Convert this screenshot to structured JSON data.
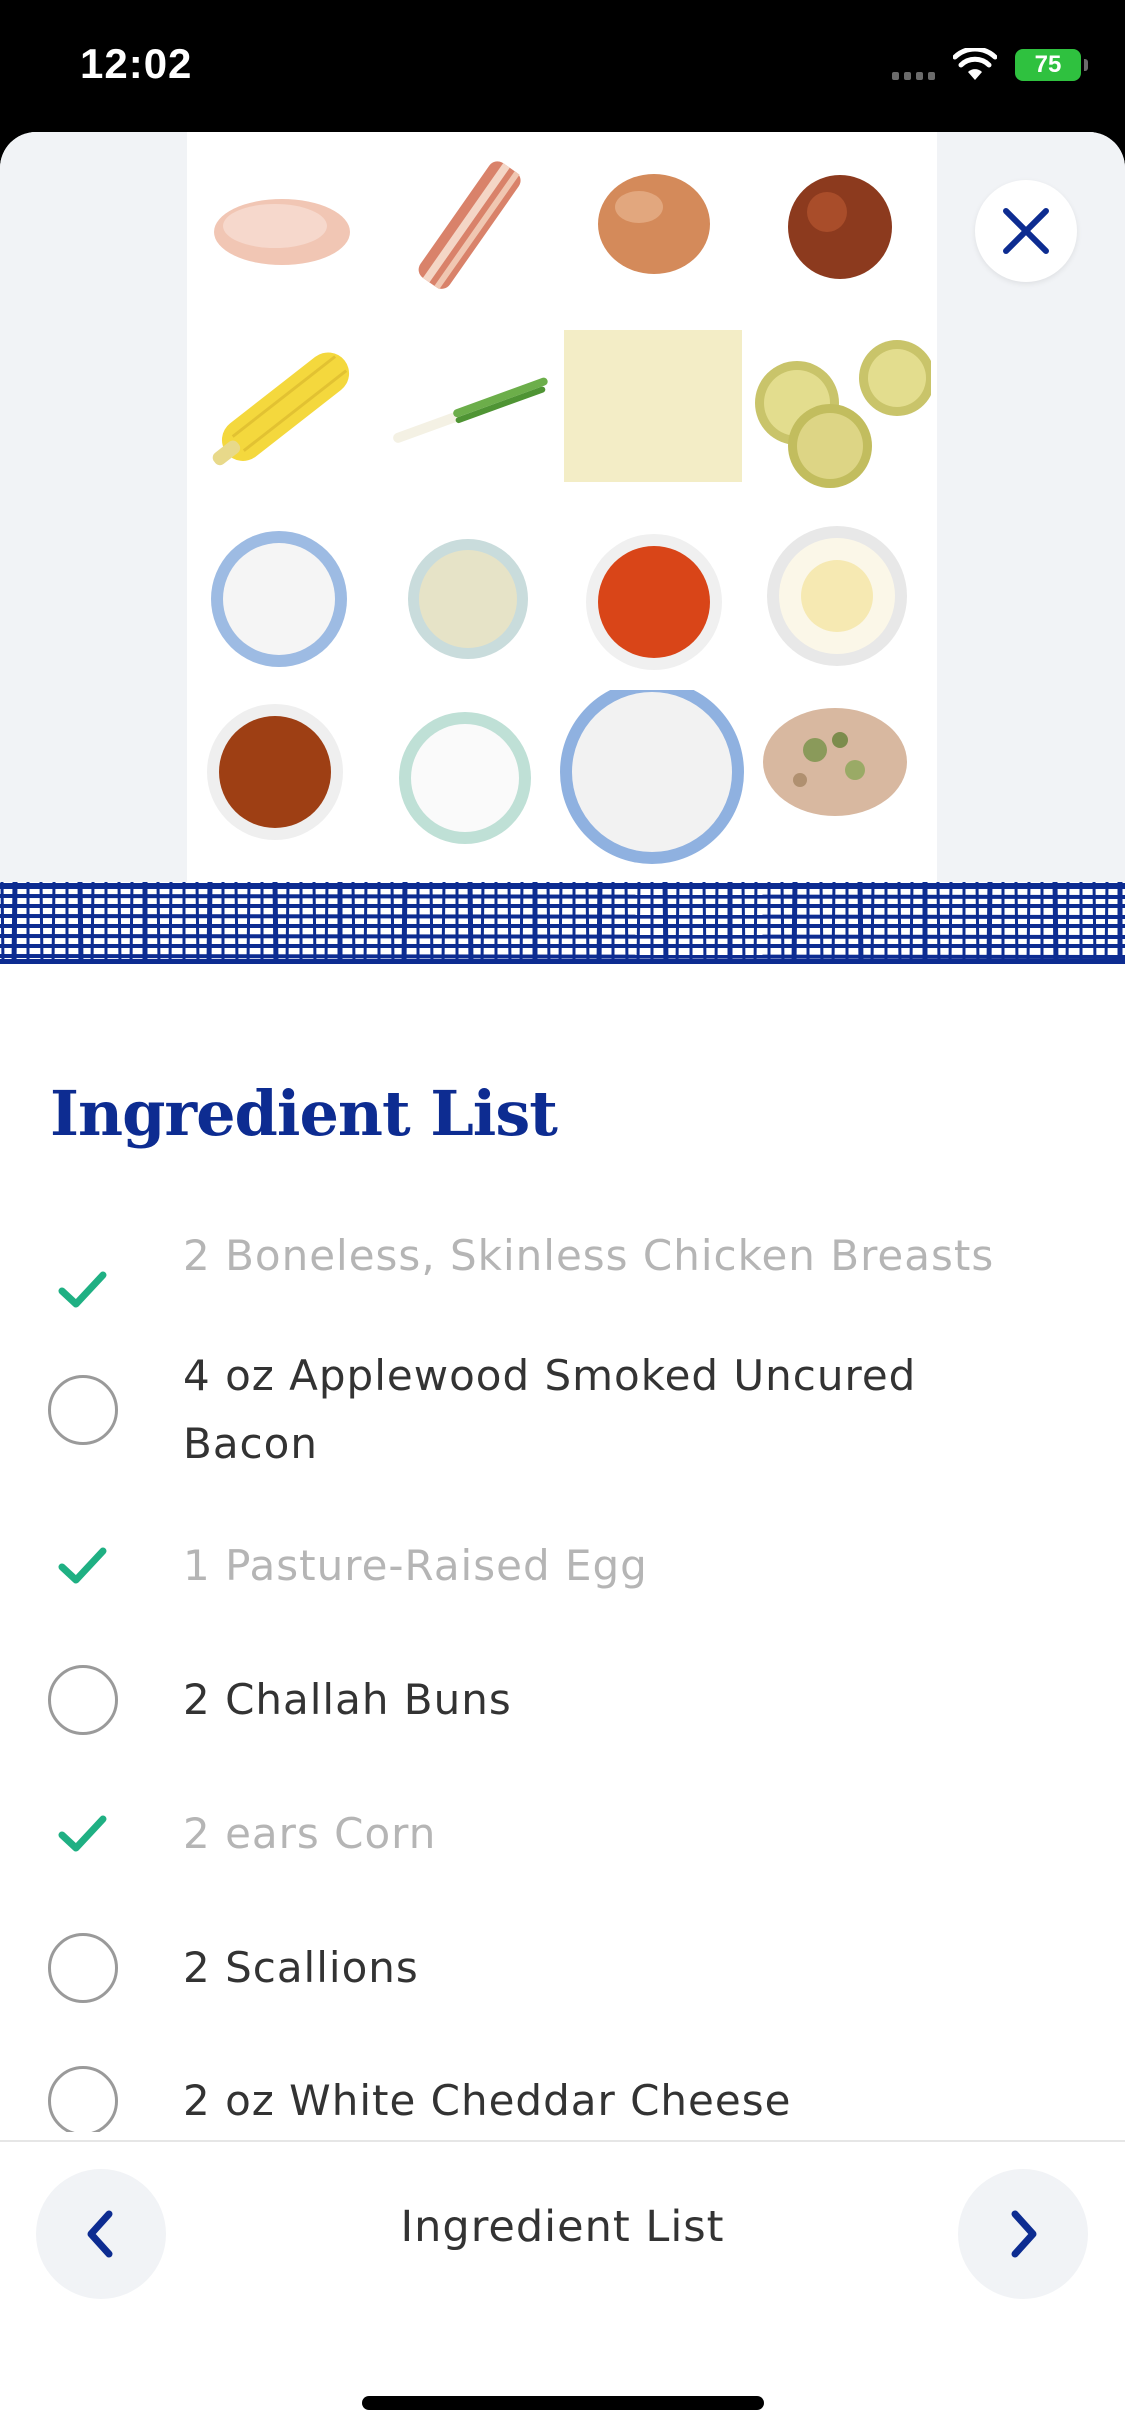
{
  "status_bar": {
    "time": "12:02",
    "battery": "75"
  },
  "hero": {
    "image_alt": "Ingredients laid out on white background"
  },
  "close": {
    "icon": "close-icon"
  },
  "section_title": "Ingredient List",
  "ingredients": [
    {
      "label": "2 Boneless, Skinless Chicken Breasts",
      "checked": true
    },
    {
      "label": "4 oz Applewood Smoked Uncured Bacon",
      "checked": false
    },
    {
      "label": "1 Pasture-Raised Egg",
      "checked": true
    },
    {
      "label": "2 Challah Buns",
      "checked": false
    },
    {
      "label": "2 ears Corn",
      "checked": true
    },
    {
      "label": "2 Scallions",
      "checked": false
    },
    {
      "label": "2 oz White Cheddar Cheese",
      "checked": false
    }
  ],
  "bottom_nav": {
    "label": "Ingredient List",
    "prev_icon": "chevron-left-icon",
    "next_icon": "chevron-right-icon"
  },
  "colors": {
    "brand_blue": "#0d2c91",
    "check_green": "#1fb083",
    "muted_text": "#b5b5b5"
  }
}
